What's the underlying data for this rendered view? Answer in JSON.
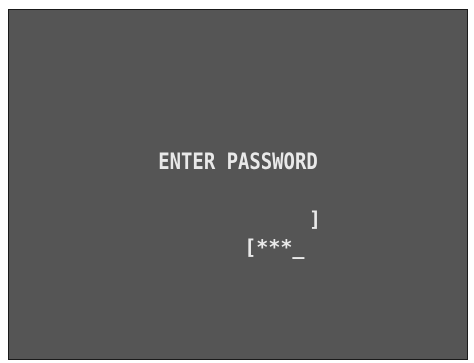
{
  "screen": {
    "prompt": "ENTER PASSWORD",
    "field": {
      "open_bracket": "[",
      "masked_value": "***",
      "cursor": "_",
      "close_bracket": "]"
    },
    "colors": {
      "background": "#555555",
      "text": "#e9e9e9",
      "frame": "#ffffff"
    }
  }
}
